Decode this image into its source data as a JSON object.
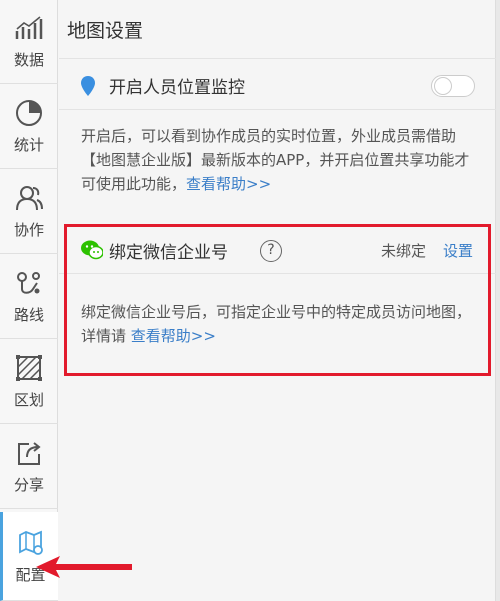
{
  "sidebar": {
    "items": [
      {
        "label": "数据",
        "icon": "bar-chart-icon"
      },
      {
        "label": "统计",
        "icon": "pie-chart-icon"
      },
      {
        "label": "协作",
        "icon": "users-icon"
      },
      {
        "label": "路线",
        "icon": "route-icon"
      },
      {
        "label": "区划",
        "icon": "region-icon"
      },
      {
        "label": "分享",
        "icon": "share-icon"
      },
      {
        "label": "配置",
        "icon": "map-settings-icon",
        "active": true
      }
    ]
  },
  "main": {
    "title": "地图设置",
    "location": {
      "label": "开启人员位置监控",
      "toggle_on": false,
      "description": "开启后，可以看到协作成员的实时位置，外业成员需借助【地图慧企业版】最新版本的APP，并开启位置共享功能才可使用此功能，",
      "help_link": "查看帮助>>"
    },
    "wechat": {
      "label": "绑定微信企业号",
      "help_symbol": "?",
      "status": "未绑定",
      "action": "设置",
      "description": "绑定微信企业号后，可指定企业号中的特定成员访问地图，详情请",
      "help_link": "查看帮助>>"
    }
  },
  "colors": {
    "accent": "#3a7ec8",
    "highlight": "#e21a2c",
    "wechat_green": "#2dc100"
  }
}
